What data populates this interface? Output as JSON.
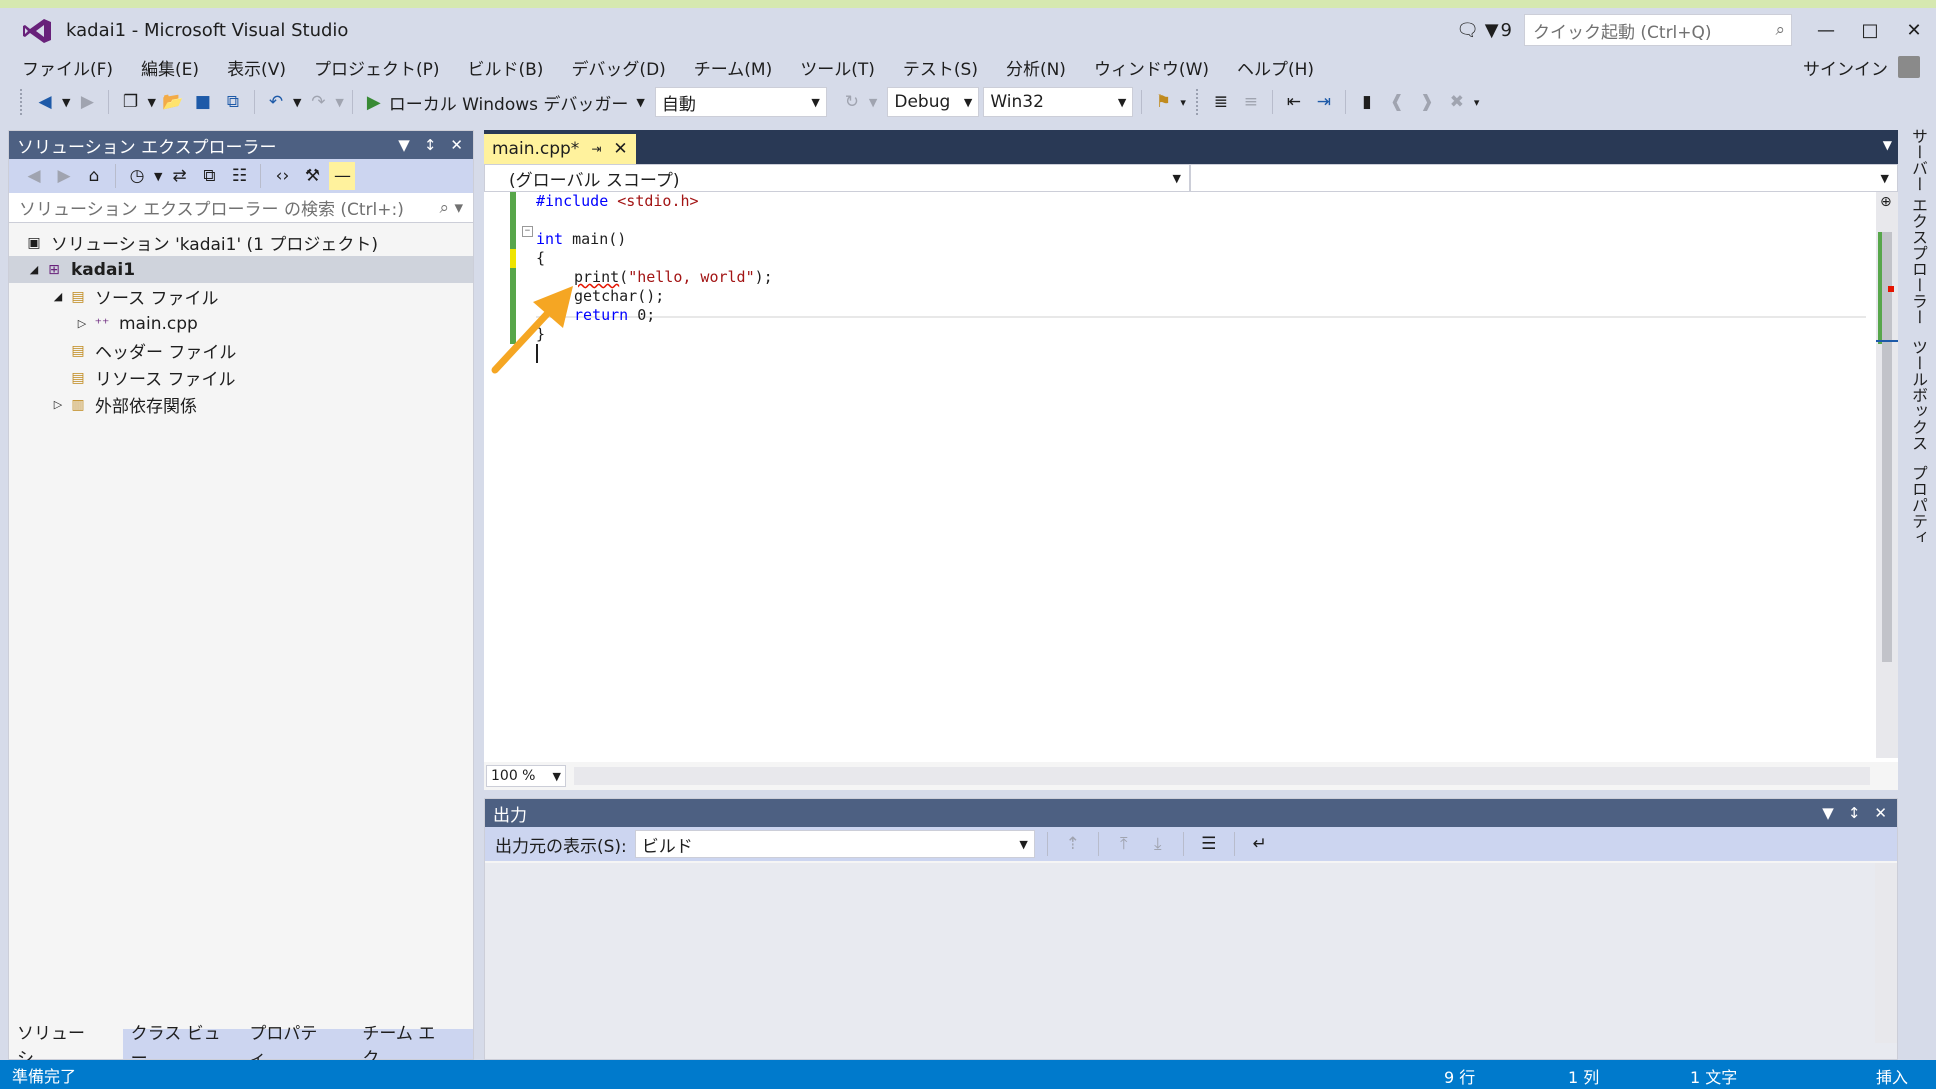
{
  "window": {
    "title": "kadai1 - Microsoft Visual Studio",
    "notification_count": "9",
    "quick_launch_placeholder": "クイック起動 (Ctrl+Q)",
    "sign_in": "サインイン"
  },
  "menu": [
    "ファイル(F)",
    "編集(E)",
    "表示(V)",
    "プロジェクト(P)",
    "ビルド(B)",
    "デバッグ(D)",
    "チーム(M)",
    "ツール(T)",
    "テスト(S)",
    "分析(N)",
    "ウィンドウ(W)",
    "ヘルプ(H)"
  ],
  "toolbar": {
    "run_label": "ローカル Windows デバッガー",
    "auto_value": "自動",
    "config_value": "Debug",
    "platform_value": "Win32"
  },
  "solution_explorer": {
    "title": "ソリューション エクスプローラー",
    "search_placeholder": "ソリューション エクスプローラー の検索 (Ctrl+:)",
    "items": [
      {
        "label": "ソリューション 'kadai1' (1 プロジェクト)"
      },
      {
        "label": "kadai1"
      },
      {
        "label": "ソース ファイル"
      },
      {
        "label": "main.cpp"
      },
      {
        "label": "ヘッダー ファイル"
      },
      {
        "label": "リソース ファイル"
      },
      {
        "label": "外部依存関係"
      }
    ],
    "tabs": [
      "ソリューシ…",
      "クラス ビュー",
      "プロパティ…",
      "チーム エク…"
    ]
  },
  "editor": {
    "tab_label": "main.cpp*",
    "scope": "(グローバル スコープ)",
    "zoom": "100 %",
    "lines": {
      "l1_pp": "#include",
      "l1_hdr": " <stdio.h>",
      "l3_kw": "int",
      "l3_rest": " main()",
      "l4": "{",
      "l5_fn": "print",
      "l5_open": "(",
      "l5_str": "\"hello, world\"",
      "l5_close": ");",
      "l6": "getchar();",
      "l7_kw": "return",
      "l7_rest": " 0;",
      "l8": "}"
    }
  },
  "output": {
    "title": "出力",
    "source_label": "出力元の表示(S):",
    "source_value": "ビルド"
  },
  "right_strip": [
    "サーバー エクスプローラー",
    "ツールボックス",
    "プロパティ"
  ],
  "status": {
    "ready": "準備完了",
    "line": "9 行",
    "col": "1 列",
    "char": "1 文字",
    "mode": "挿入"
  },
  "colors": {
    "accent": "#007acc",
    "panel_header": "#4d6082",
    "active_tab": "#fff29d",
    "arrow": "#f5a623"
  }
}
